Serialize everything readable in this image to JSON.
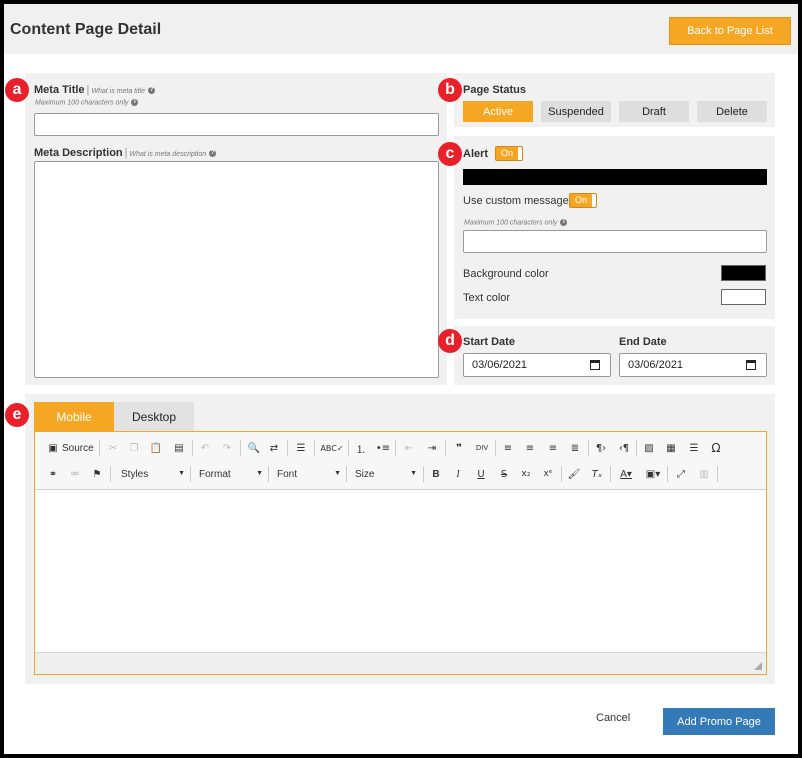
{
  "header": {
    "title": "Content Page Detail",
    "back_button": "Back to Page List"
  },
  "markers": [
    "a",
    "b",
    "c",
    "d",
    "e"
  ],
  "meta": {
    "title_label": "Meta Title",
    "title_hint": "What is meta title",
    "title_sub": "Maximum 100 characters only",
    "title_value": "",
    "description_label": "Meta Description",
    "description_hint": "What is meta description",
    "description_value": ""
  },
  "status": {
    "label": "Page Status",
    "buttons": [
      {
        "label": "Active",
        "selected": true
      },
      {
        "label": "Suspended",
        "selected": false
      },
      {
        "label": "Draft",
        "selected": false
      },
      {
        "label": "Delete",
        "selected": false
      }
    ]
  },
  "alert": {
    "label": "Alert",
    "toggle": "On",
    "custom_message_label": "Use custom message",
    "custom_toggle": "On",
    "custom_sub": "Maximum 100 characters only",
    "custom_value": "",
    "bg_color_label": "Background color",
    "bg_color": "#000000",
    "text_color_label": "Text color",
    "text_color": "#ffffff"
  },
  "dates": {
    "start_label": "Start Date",
    "start_value": "03/06/2021",
    "end_label": "End Date",
    "end_value": "03/06/2021"
  },
  "editor": {
    "tabs": [
      "Mobile",
      "Desktop"
    ],
    "selected_tab": "Mobile",
    "source_label": "Source",
    "styles_label": "Styles",
    "format_label": "Format",
    "font_label": "Font",
    "size_label": "Size"
  },
  "footer": {
    "cancel": "Cancel",
    "submit": "Add Promo Page"
  },
  "colors": {
    "accent": "#f5a623",
    "primary": "#337ab7",
    "marker": "#e8202a"
  }
}
